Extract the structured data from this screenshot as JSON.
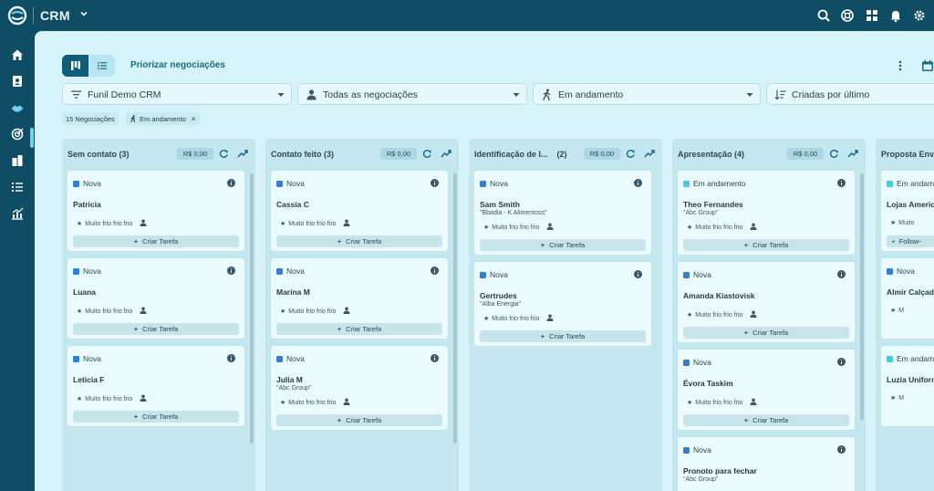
{
  "app": {
    "title": "CRM"
  },
  "toolbar": {
    "prioritize_label": "Priorizar negociações"
  },
  "filters": {
    "funnel": "Funil Demo CRM",
    "deals": "Todas as negociações",
    "status": "Em andamento",
    "sort": "Criadas por último"
  },
  "chips": {
    "count": "15 Negociações",
    "status": "Em andamento",
    "remove": "×"
  },
  "colors": {
    "nova": "#2f7fd6",
    "em_andamento": "#4cc8ea",
    "accent": "#0f5c78"
  },
  "columns": [
    {
      "title": "Sem contato",
      "count": "(3)",
      "amount": "R$ 0,00",
      "cards": [
        {
          "tag": "Nova",
          "name": "Patricia",
          "company": "",
          "meta": "Muito frio frio frio",
          "task": "Criar Tarefa"
        },
        {
          "tag": "Nova",
          "name": "Luana",
          "company": "",
          "meta": "Muito frio frio frio",
          "task": "Criar Tarefa"
        },
        {
          "tag": "Nova",
          "name": "Leticia F",
          "company": "",
          "meta": "Muito frio frio frio",
          "task": "Criar Tarefa"
        }
      ]
    },
    {
      "title": "Contato feito",
      "count": "(3)",
      "amount": "R$ 0,00",
      "cards": [
        {
          "tag": "Nova",
          "name": "Cassia C",
          "company": "",
          "meta": "Muito frio frio frio",
          "task": "Criar Tarefa"
        },
        {
          "tag": "Nova",
          "name": "Marina M",
          "company": "",
          "meta": "Muito frio frio frio",
          "task": "Criar Tarefa"
        },
        {
          "tag": "Nova",
          "name": "Julia M",
          "company": "\"Abc Group\"",
          "meta": "Muito frio frio frio",
          "task": "Criar Tarefa"
        }
      ]
    },
    {
      "title": "Identificação de I...",
      "count": "(2)",
      "amount": "R$ 0,00",
      "cards": [
        {
          "tag": "Nova",
          "name": "Sam Smith",
          "company": "\"Bbadia - K Alimentoss\"",
          "meta": "Muito frio frio frio",
          "task": "Criar Tarefa"
        },
        {
          "tag": "Nova",
          "name": "Gertrudes",
          "company": "\"Alba Energia\"",
          "meta": "Muito frio frio frio",
          "task": "Criar Tarefa"
        }
      ]
    },
    {
      "title": "Apresentação",
      "count": "(4)",
      "amount": "R$ 0,00",
      "cards": [
        {
          "tag": "Em andamento",
          "name": "Theo Fernandes",
          "company": "\"Abc Group\"",
          "meta": "Muito frio frio frio",
          "task": "Criar Tarefa"
        },
        {
          "tag": "Nova",
          "name": "Amanda Kiastovisk",
          "company": "",
          "meta": "Muito frio frio frio",
          "task": "Criar Tarefa"
        },
        {
          "tag": "Nova",
          "name": "Évora Taskim",
          "company": "",
          "meta": "Muito frio frio frio",
          "task": "Criar Tarefa"
        },
        {
          "tag": "Nova",
          "name": "Pronoto para fechar",
          "company": "\"Abc Group\""
        }
      ]
    },
    {
      "title": "Proposta Envia",
      "cards": [
        {
          "tag": "Em andamento",
          "name": "Lojas Americ",
          "meta": "Muito",
          "task": "Follow-"
        },
        {
          "tag": "Nova",
          "name": "Almir Calçade",
          "meta": "M"
        },
        {
          "tag": "Em andame",
          "name": "Luzia Uniform",
          "meta": "M"
        }
      ]
    }
  ]
}
